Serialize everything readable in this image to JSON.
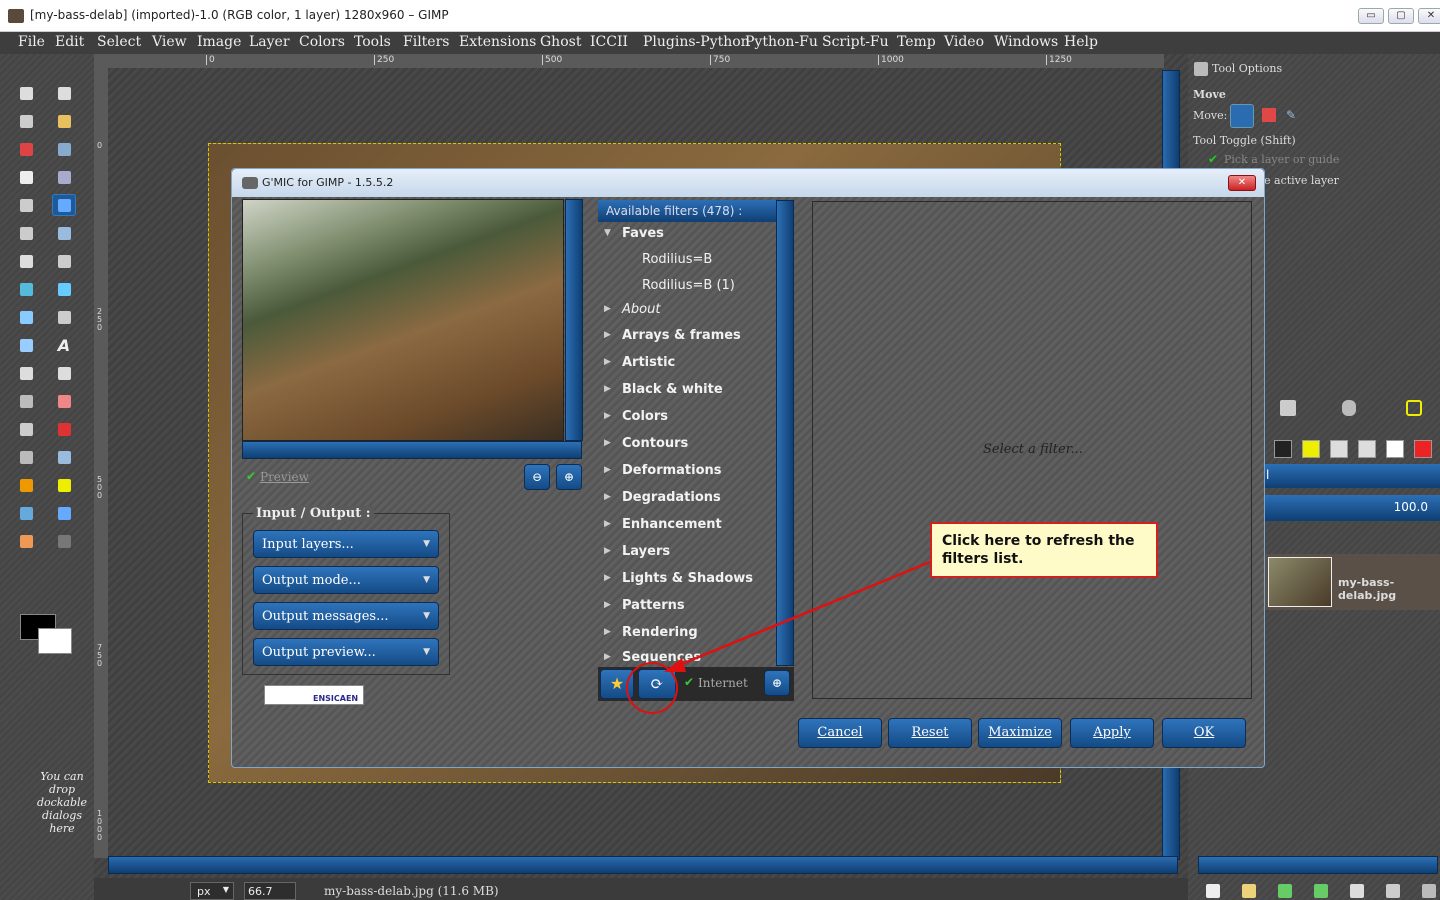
{
  "window": {
    "title": "[my-bass-delab] (imported)-1.0 (RGB color, 1 layer) 1280x960 – GIMP",
    "min": "▭",
    "max": "▢",
    "close": "✕"
  },
  "menu": [
    "File",
    "Edit",
    "Select",
    "View",
    "Image",
    "Layer",
    "Colors",
    "Tools",
    "Filters",
    "Extensions",
    "Ghost",
    "ICCII",
    "Plugins-Python",
    "Python-Fu",
    "Script-Fu",
    "Temp",
    "Video",
    "Windows",
    "Help"
  ],
  "ruler": {
    "top": [
      "0",
      "250",
      "500",
      "750",
      "1000",
      "1250"
    ],
    "left": [
      "0",
      "250",
      "500",
      "750",
      "1000"
    ]
  },
  "toolbox": {
    "drop_note": "You can drop dockable dialogs here"
  },
  "tool_options": {
    "title": "Tool Options",
    "tool": "Move",
    "move_label": "Move:",
    "toggle": "Tool Toggle  (Shift)",
    "pick": "Pick a layer or guide",
    "active": "e active layer"
  },
  "layers": {
    "mode_tail": "l",
    "opacity": "100.0",
    "layer_name": "my-bass-delab.jpg",
    "icons": [
      "brush-icon",
      "pattern-icon",
      "gradient-icon",
      "contrast-icon",
      "curves-icon",
      "warning-icon"
    ]
  },
  "status": {
    "unit": "px",
    "zoom": "66.7",
    "file": "my-bass-delab.jpg (11.6 MB)"
  },
  "gmic": {
    "title": "G'MIC for GIMP - 1.5.5.2",
    "preview_label": "Preview",
    "io_title": "Input / Output  :",
    "io": [
      "Input layers...",
      "Output mode...",
      "Output messages...",
      "Output preview..."
    ],
    "logo": "ENSICAEN",
    "filters_header": "Available filters (478) :",
    "filters": [
      {
        "label": "Faves",
        "tri": "▼",
        "italic": false,
        "sub": false
      },
      {
        "label": "Rodilius=B",
        "tri": "",
        "italic": false,
        "sub": true
      },
      {
        "label": "Rodilius=B (1)",
        "tri": "",
        "italic": false,
        "sub": true
      },
      {
        "label": "About",
        "tri": "▶",
        "italic": true,
        "sub": false
      },
      {
        "label": "Arrays & frames",
        "tri": "▶",
        "italic": false,
        "sub": false
      },
      {
        "label": "Artistic",
        "tri": "▶",
        "italic": false,
        "sub": false
      },
      {
        "label": "Black & white",
        "tri": "▶",
        "italic": false,
        "sub": false
      },
      {
        "label": "Colors",
        "tri": "▶",
        "italic": false,
        "sub": false
      },
      {
        "label": "Contours",
        "tri": "▶",
        "italic": false,
        "sub": false
      },
      {
        "label": "Deformations",
        "tri": "▶",
        "italic": false,
        "sub": false
      },
      {
        "label": "Degradations",
        "tri": "▶",
        "italic": false,
        "sub": false
      },
      {
        "label": "Enhancement",
        "tri": "▶",
        "italic": false,
        "sub": false
      },
      {
        "label": "Layers",
        "tri": "▶",
        "italic": false,
        "sub": false
      },
      {
        "label": "Lights & Shadows",
        "tri": "▶",
        "italic": false,
        "sub": false
      },
      {
        "label": "Patterns",
        "tri": "▶",
        "italic": false,
        "sub": false
      },
      {
        "label": "Rendering",
        "tri": "▶",
        "italic": false,
        "sub": false
      },
      {
        "label": "Sequences",
        "tri": "▶",
        "italic": false,
        "sub": false
      }
    ],
    "internet": "Internet",
    "placeholder": "Select a filter...",
    "buttons": [
      "Cancel",
      "Reset",
      "Maximize",
      "Apply",
      "OK"
    ]
  },
  "callout": {
    "text": "Click here to refresh the filters list."
  }
}
